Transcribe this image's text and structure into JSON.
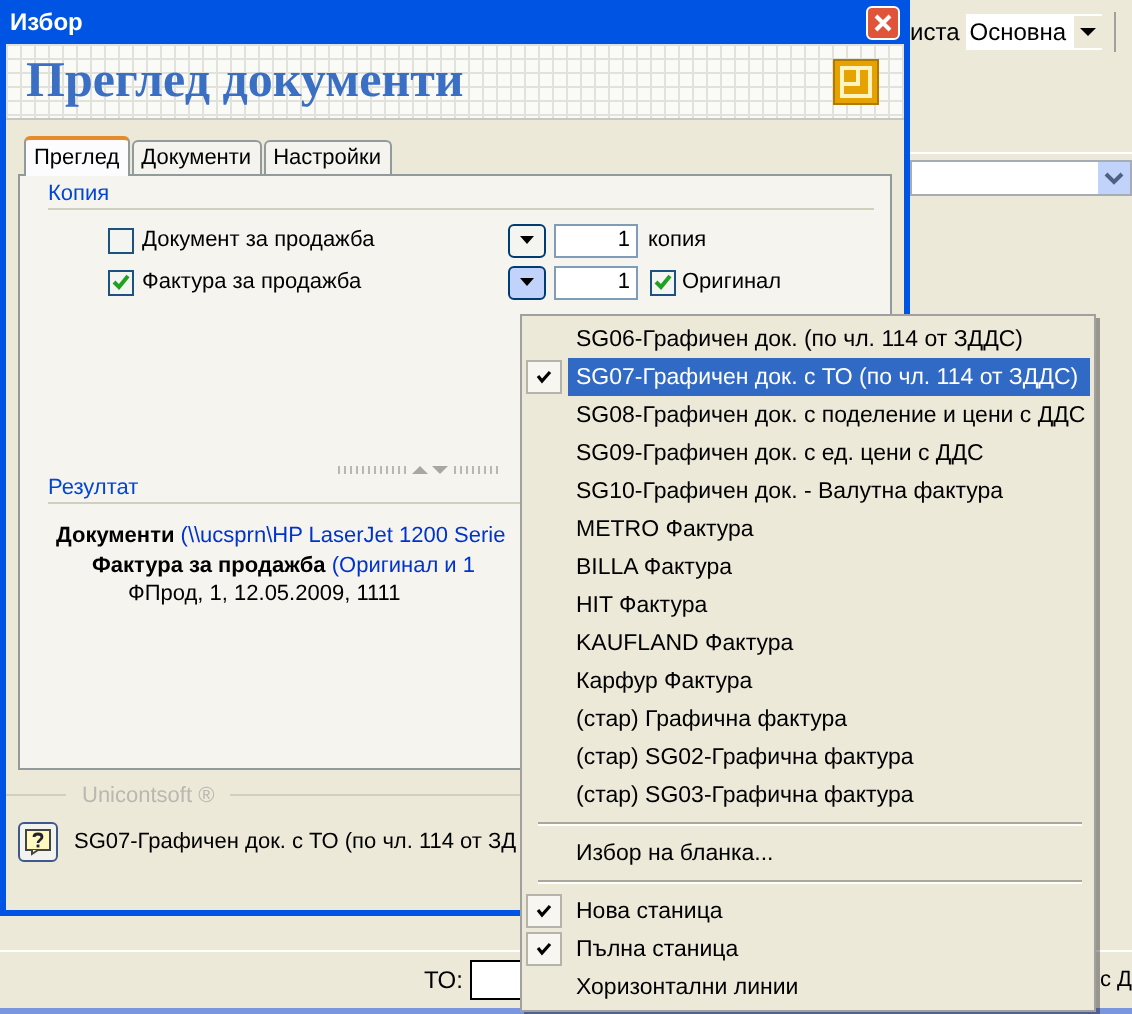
{
  "background_app": {
    "toolbar_label": "иста",
    "view_select": "Основна",
    "to_label": "ТО:",
    "bottom_cut_label": "с Д"
  },
  "window": {
    "title": "Избор",
    "heading": "Преглед документи"
  },
  "tabs": [
    {
      "label": "Преглед",
      "selected": true
    },
    {
      "label": "Документи",
      "selected": false
    },
    {
      "label": "Настройки",
      "selected": false
    }
  ],
  "copies": {
    "title": "Копия",
    "rows": [
      {
        "label": "Документ за продажба",
        "checked": false,
        "count": "1",
        "suffix": {
          "kind": "text",
          "label": "копия"
        },
        "menu_open": false
      },
      {
        "label": "Фактура за продажба",
        "checked": true,
        "count": "1",
        "suffix": {
          "kind": "checkbox",
          "label": "Оригинал",
          "checked": true
        },
        "menu_open": true
      }
    ]
  },
  "result": {
    "title": "Резултат",
    "tree": [
      {
        "label": "Документи",
        "detail": "(\\\\ucsprn\\HP LaserJet 1200 Serie",
        "children": [
          {
            "label": "Фактура за продажба",
            "detail": "(Оригинал и 1",
            "children": [
              {
                "label": "ФПрод, 1, 12.05.2009, 1111"
              }
            ]
          }
        ]
      }
    ]
  },
  "footer": {
    "brand": "Unicontsoft ®",
    "status": "SG07-Графичен док. с ТО (по чл. 114 от ЗД"
  },
  "menu": [
    {
      "kind": "item",
      "label": "SG06-Графичен док. (по чл. 114 от ЗДДС)",
      "checked": false,
      "selected": false
    },
    {
      "kind": "item",
      "label": "SG07-Графичен док. с ТО (по чл. 114 от ЗДДС)",
      "checked": true,
      "selected": true
    },
    {
      "kind": "item",
      "label": "SG08-Графичен док. с поделение и цени с ДДС",
      "checked": false,
      "selected": false
    },
    {
      "kind": "item",
      "label": "SG09-Графичен док. с ед. цени с ДДС",
      "checked": false,
      "selected": false
    },
    {
      "kind": "item",
      "label": "SG10-Графичен док. - Валутна фактура",
      "checked": false,
      "selected": false
    },
    {
      "kind": "item",
      "label": "METRO Фактура",
      "checked": false,
      "selected": false
    },
    {
      "kind": "item",
      "label": "BILLA Фактура",
      "checked": false,
      "selected": false
    },
    {
      "kind": "item",
      "label": "HIT Фактура",
      "checked": false,
      "selected": false
    },
    {
      "kind": "item",
      "label": "KAUFLAND Фактура",
      "checked": false,
      "selected": false
    },
    {
      "kind": "item",
      "label": "Карфур Фактура",
      "checked": false,
      "selected": false
    },
    {
      "kind": "item",
      "label": "(стар) Графична фактура",
      "checked": false,
      "selected": false
    },
    {
      "kind": "item",
      "label": "(стар) SG02-Графична фактура",
      "checked": false,
      "selected": false
    },
    {
      "kind": "item",
      "label": "(стар) SG03-Графична фактура",
      "checked": false,
      "selected": false
    },
    {
      "kind": "separator"
    },
    {
      "kind": "item",
      "label": "Избор на бланка...",
      "checked": false,
      "selected": false
    },
    {
      "kind": "separator"
    },
    {
      "kind": "item",
      "label": "Нова станица",
      "checked": true,
      "selected": false
    },
    {
      "kind": "item",
      "label": "Пълна станица",
      "checked": true,
      "selected": false
    },
    {
      "kind": "item",
      "label": "Хоризонтални линии",
      "checked": false,
      "selected": false
    }
  ]
}
